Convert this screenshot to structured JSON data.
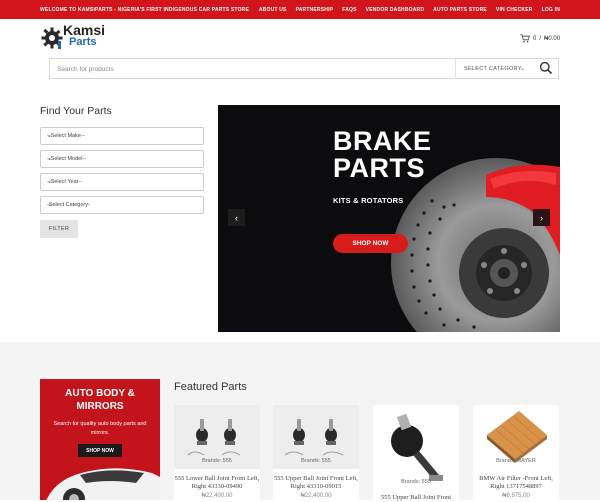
{
  "topbar": {
    "welcome": "WELCOME TO KAMSIPARTS - NIGERIA'S FIRST INDIGENOUS CAR PARTS STORE",
    "links": [
      "ABOUT US",
      "PARTNERSHIP",
      "FAQS",
      "VENDOR DASHBOARD",
      "AUTO PARTS STORE",
      "VIN CHECKER",
      "LOG IN"
    ]
  },
  "logo": {
    "word1": "Kamsi",
    "word2": "Parts"
  },
  "cart": {
    "count": "0",
    "separator": "/",
    "total": "₦0.00"
  },
  "search": {
    "placeholder": "Search for products",
    "category_label": "SELECT CATEGORY"
  },
  "finder": {
    "title": "Find Your Parts",
    "selects": [
      "--Select Make--",
      "--Select Model--",
      "--Select Year--",
      "-Select Category-"
    ],
    "filter_label": "FILTER"
  },
  "banner": {
    "line1": "BRAKE",
    "line2": "PARTS",
    "subtitle": "KITS & ROTATORS",
    "button": "SHOP NOW"
  },
  "promo": {
    "title_line1": "AUTO BODY &",
    "title_line2": "MIRRORS",
    "subtitle": "Search for quality auto body parts and mirrors.",
    "button": "SHOP NOW"
  },
  "featured": {
    "title": "Featured Parts",
    "products": [
      {
        "brand": "Brands: 555",
        "name": "555 Lower Ball Joint Front Left, Right 43330-09490",
        "price": "₦22,400.00"
      },
      {
        "brand": "Brands: 555",
        "name": "555 Upper Ball Joint Front Left, Right 43310-09015",
        "price": "₦22,400.00"
      },
      {
        "brand": "Brands: 555",
        "name": "555 Upper Ball Joint Front",
        "price": ""
      },
      {
        "brand": "Brands: MAYER",
        "name": "BMW Air Filter -Front Left, Right 13717548897",
        "price": "₦6,975.00"
      }
    ]
  },
  "colors": {
    "brand_red": "#d2141b",
    "logo_blue": "#1c6ab0",
    "banner_bg": "#0c0c0e"
  }
}
